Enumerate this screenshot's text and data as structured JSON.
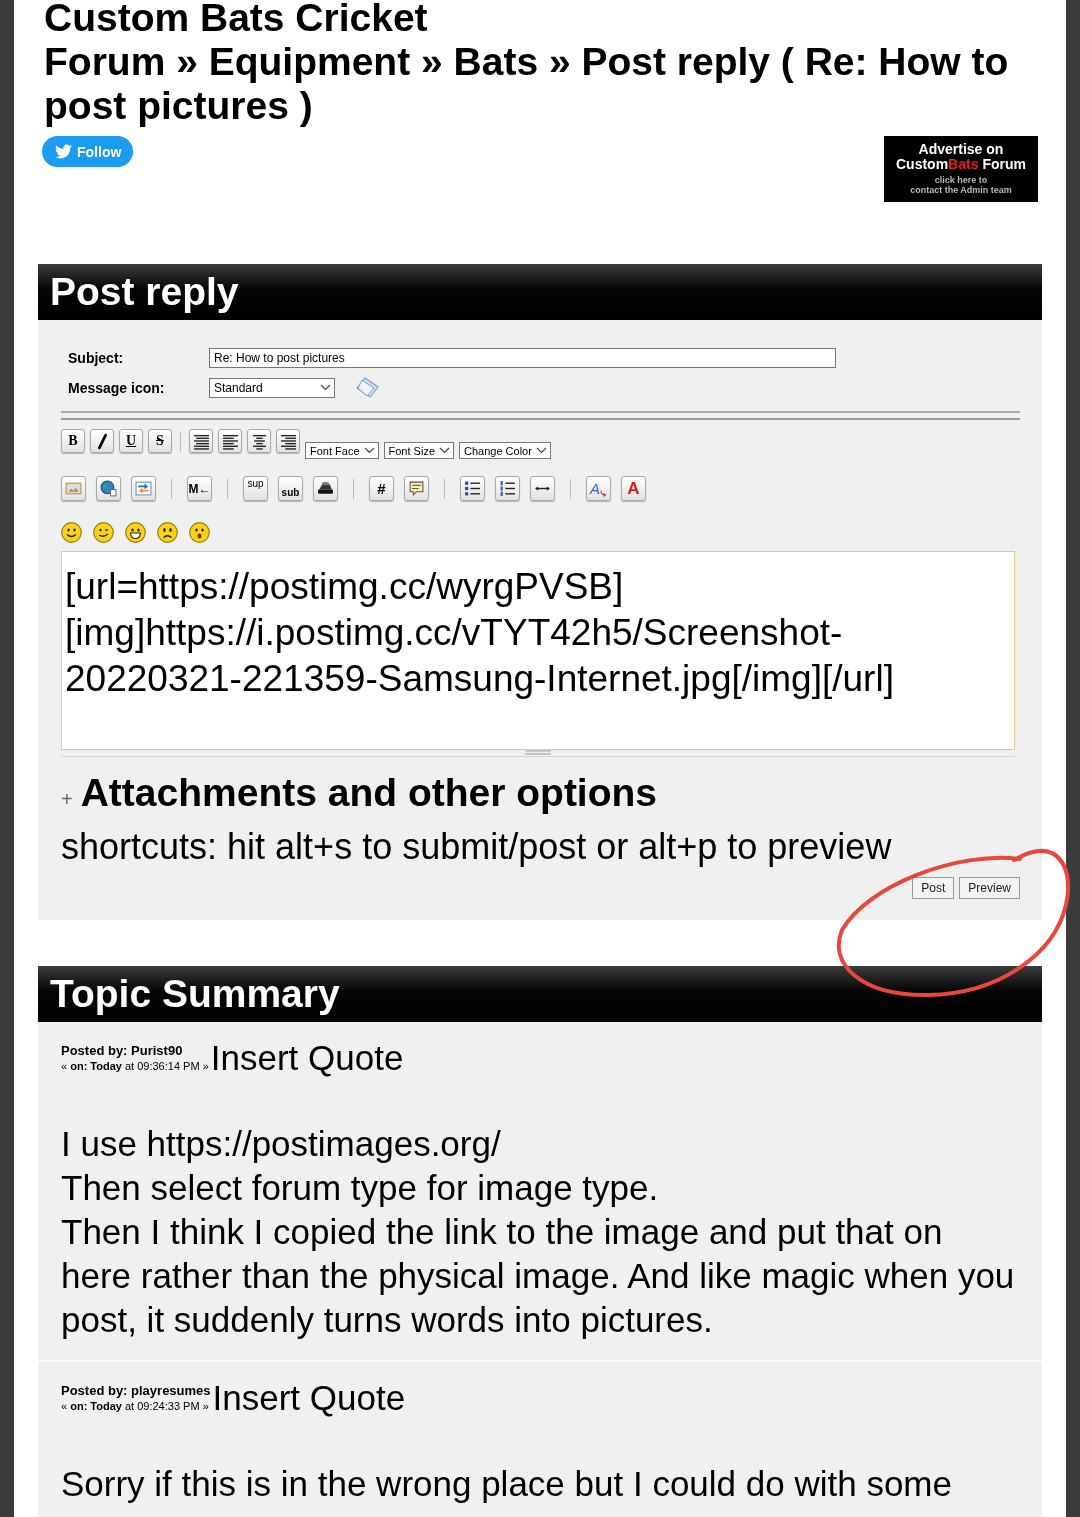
{
  "page_title": {
    "line_1": "Custom Bats Cricket",
    "line_2": "Forum » Equipment » Bats » Post reply ( Re: How to post pictures )"
  },
  "follow_button": {
    "label": "Follow"
  },
  "ad_banner": {
    "heading": "Advertise on",
    "brand_start": "Custom",
    "brand_highlight": "Bats",
    "brand_end": "Forum",
    "note_line_1": "click here to",
    "note_line_2": "contact the Admin team"
  },
  "post_reply": {
    "title": "Post reply",
    "subject": {
      "label": "Subject:",
      "value": "Re: How to post pictures"
    },
    "message_icon": {
      "label": "Message icon:",
      "value": "Standard"
    },
    "toolbar_rows": [
      [
        {
          "kind": "bold",
          "label": "B"
        },
        {
          "kind": "italic"
        },
        {
          "kind": "underline",
          "label": "U"
        },
        {
          "kind": "strike",
          "label": "S"
        },
        {
          "kind": "separator"
        },
        {
          "kind": "justify"
        },
        {
          "kind": "left"
        },
        {
          "kind": "center"
        },
        {
          "kind": "right"
        },
        {
          "kind": "select",
          "label": "Font Face"
        },
        {
          "kind": "select",
          "label": "Font Size"
        },
        {
          "kind": "select",
          "label": "Change Color"
        }
      ],
      [
        {
          "kind": "image"
        },
        {
          "kind": "globe"
        },
        {
          "kind": "swap"
        },
        {
          "kind": "separator"
        },
        {
          "kind": "markdown",
          "label": "M←"
        },
        {
          "kind": "separator"
        },
        {
          "kind": "sup",
          "label": "sup"
        },
        {
          "kind": "sub",
          "label": "sub"
        },
        {
          "kind": "typewriter"
        },
        {
          "kind": "separator"
        },
        {
          "kind": "code",
          "label": "#"
        },
        {
          "kind": "quote"
        },
        {
          "kind": "separator"
        },
        {
          "kind": "bullets"
        },
        {
          "kind": "numbers"
        },
        {
          "kind": "rule"
        },
        {
          "kind": "separator"
        },
        {
          "kind": "font",
          "label": "A"
        },
        {
          "kind": "color",
          "label": "A"
        }
      ]
    ],
    "smileys": [
      {
        "kind": "smile"
      },
      {
        "kind": "wink"
      },
      {
        "kind": "grin"
      },
      {
        "kind": "sad"
      },
      {
        "kind": "shocked"
      }
    ],
    "message": {
      "value": "[url=https://postimg.cc/wyrgPVSB][img]https://i.postimg.cc/vTYT42h5/Screenshot-20220321-221359-Samsung-Internet.jpg[/img][/url]"
    },
    "attachments": {
      "toggle": "+",
      "heading": "Attachments and other options"
    },
    "shortcuts": "shortcuts: hit alt+s to submit/post or alt+p to preview",
    "buttons": [
      {
        "label": "Post"
      },
      {
        "label": "Preview"
      }
    ]
  },
  "topic_summary": {
    "title": "Topic Summary",
    "posts": [
      {
        "author_line": "Posted by: Purist90",
        "date": "« **on: Today** at 09:36:14 PM »",
        "quote_link": "Insert Quote",
        "body_lines": [
          "I use https://postimages.org/",
          "Then select forum type for image type.",
          "Then I think I copied the link to the image and put that on here rather than the physical image. And like magic when you post, it suddenly turns words into pictures."
        ]
      },
      {
        "author_line": "Posted by: playresumes",
        "date": "« **on: Today** at 09:24:33 PM »",
        "quote_link": "Insert Quote",
        "body_lines": [
          "Sorry if this is in the wrong place but I could do with some"
        ]
      }
    ]
  }
}
